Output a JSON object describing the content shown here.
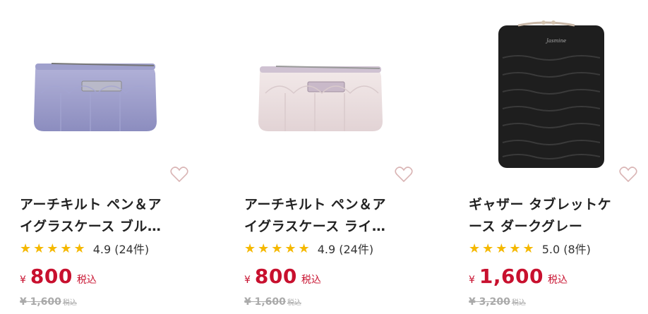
{
  "products": [
    {
      "title_line1": "アーチキルト ペン＆ア",
      "title_line2": "イグラスケース ブル…",
      "stars": "★★★★★",
      "rating_text": "4.9 (24件)",
      "currency": "¥",
      "price": "800",
      "tax_label": "税込",
      "original_price": "¥ 1,600",
      "original_tax_label": "税込",
      "image_icon": "lavender-pen-case-image",
      "image_color": "#9b9cc8"
    },
    {
      "title_line1": "アーチキルト ペン＆ア",
      "title_line2": "イグラスケース ライ…",
      "stars": "★★★★★",
      "rating_text": "4.9 (24件)",
      "currency": "¥",
      "price": "800",
      "tax_label": "税込",
      "original_price": "¥ 1,600",
      "original_tax_label": "税込",
      "image_icon": "light-pink-pen-case-image",
      "image_color": "#ecdfe0"
    },
    {
      "title_line1": "ギャザー タブレットケ",
      "title_line2": "ース ダークグレー",
      "stars": "★★★★★",
      "rating_text": "5.0 (8件)",
      "currency": "¥",
      "price": "1,600",
      "tax_label": "税込",
      "original_price": "¥ 3,200",
      "original_tax_label": "税込",
      "image_icon": "dark-gray-tablet-case-image",
      "image_color": "#1e1e1e"
    }
  ],
  "colors": {
    "price": "#c8102e",
    "star": "#f5b800",
    "heart": "#d9b4b4"
  }
}
